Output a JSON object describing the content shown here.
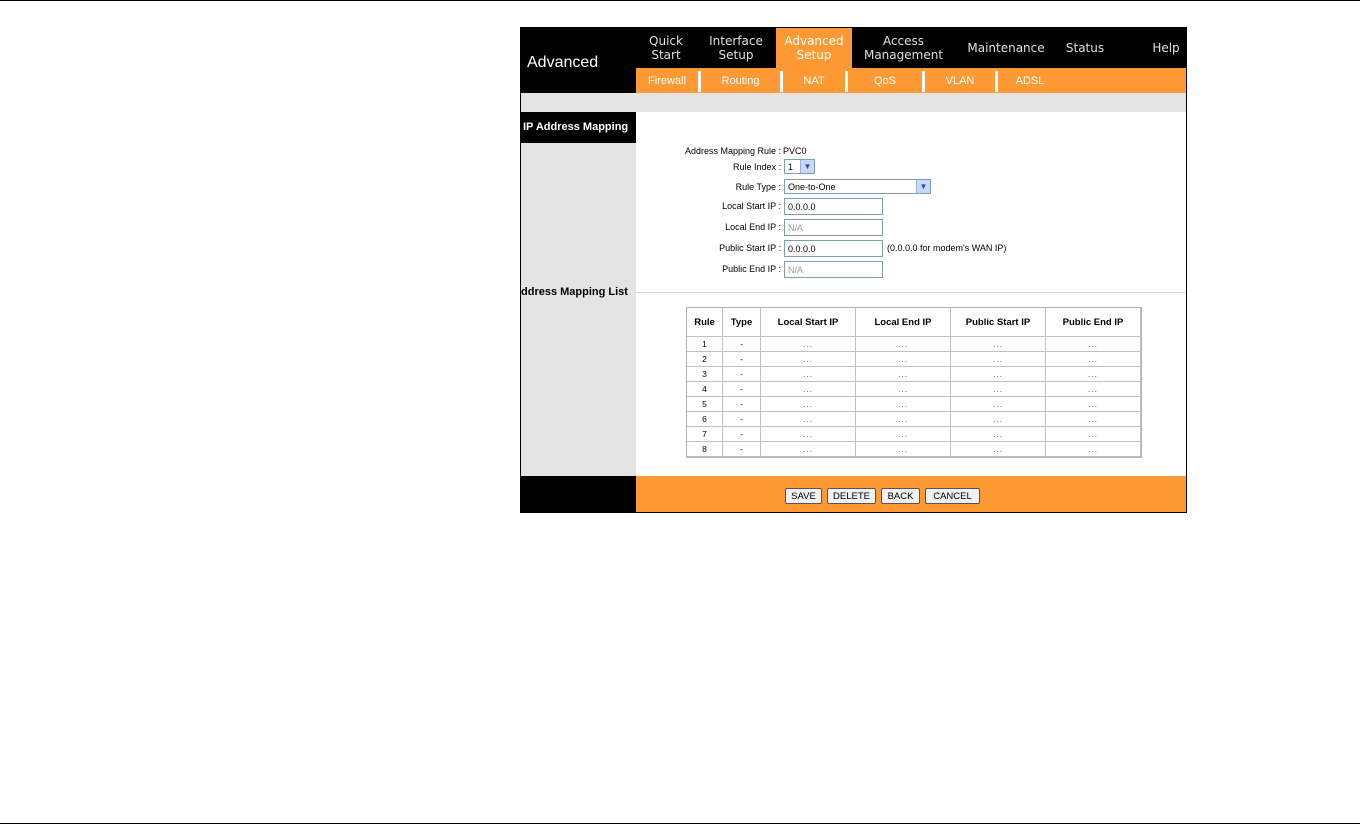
{
  "header": {
    "title": "Advanced"
  },
  "topnav": [
    {
      "label": "Quick\nStart",
      "active": false
    },
    {
      "label": "Interface\nSetup",
      "active": false
    },
    {
      "label": "Advanced\nSetup",
      "active": true
    },
    {
      "label": "Access\nManagement",
      "active": false
    },
    {
      "label": "Maintenance",
      "active": false
    },
    {
      "label": "Status",
      "active": false
    },
    {
      "label": "Help",
      "active": false
    }
  ],
  "subnav": [
    "Firewall",
    "Routing",
    "NAT",
    "QoS",
    "VLAN",
    "ADSL"
  ],
  "sections": {
    "mapping": "IP Address Mapping",
    "list": "ddress Mapping List"
  },
  "form": {
    "rule_label": "Address Mapping Rule :",
    "rule_value": "PVC0",
    "index_label": "Rule Index :",
    "index_value": "1",
    "type_label": "Rule Type :",
    "type_value": "One-to-One",
    "local_start_label": "Local Start IP :",
    "local_start_value": "0.0.0.0",
    "local_end_label": "Local End IP :",
    "local_end_value": "N/A",
    "public_start_label": "Public Start IP :",
    "public_start_value": "0.0.0.0",
    "public_start_hint": "(0.0.0.0 for modem's WAN IP)",
    "public_end_label": "Public End IP :",
    "public_end_value": "N/A"
  },
  "table": {
    "headers": [
      "Rule",
      "Type",
      "Local Start IP",
      "Local End IP",
      "Public Start IP",
      "Public End IP"
    ],
    "rows": [
      [
        "1",
        "-",
        "...",
        "...",
        "...",
        "..."
      ],
      [
        "2",
        "-",
        "...",
        "...",
        "...",
        "..."
      ],
      [
        "3",
        "-",
        "...",
        "...",
        "...",
        "..."
      ],
      [
        "4",
        "-",
        "...",
        "...",
        "...",
        "..."
      ],
      [
        "5",
        "-",
        "...",
        "...",
        "...",
        "..."
      ],
      [
        "6",
        "-",
        "...",
        "...",
        "...",
        "..."
      ],
      [
        "7",
        "-",
        "...",
        "...",
        "...",
        "..."
      ],
      [
        "8",
        "-",
        "...",
        "...",
        "...",
        "..."
      ]
    ]
  },
  "buttons": {
    "save": "SAVE",
    "delete": "DELETE",
    "back": "BACK",
    "cancel": "CANCEL"
  },
  "colors": {
    "accent": "#ff9933",
    "header": "#000000",
    "sidebar": "#e4e4e4"
  },
  "icons": {
    "dropdown": "chevron-down-icon"
  }
}
